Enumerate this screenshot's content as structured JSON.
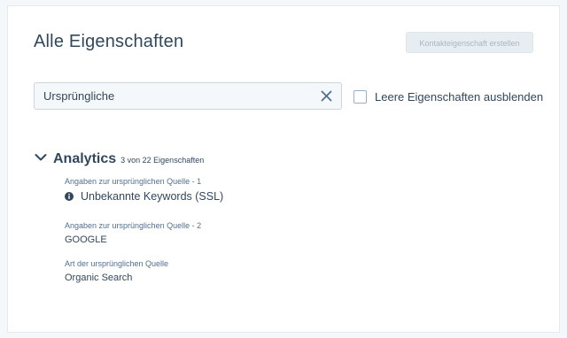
{
  "header": {
    "title": "Alle Eigenschaften",
    "create_button_label": "Kontakteigenschaft erstellen"
  },
  "search": {
    "value": "Ursprüngliche",
    "placeholder": "",
    "clear_icon": "close-icon"
  },
  "filter": {
    "hide_empty_label": "Leere Eigenschaften ausblenden",
    "hide_empty_checked": false
  },
  "section": {
    "title": "Analytics",
    "count_text": "3 von 22 Eigenschaften",
    "expanded": true,
    "properties": [
      {
        "label": "Angaben zur ursprünglichen Quelle - 1",
        "value": "Unbekannte Keywords (SSL)",
        "icon": "info-icon"
      },
      {
        "label": "Angaben zur ursprünglichen Quelle - 2",
        "value": "GOOGLE"
      },
      {
        "label": "Art der ursprünglichen Quelle",
        "value": "Organic Search"
      }
    ]
  },
  "colors": {
    "background": "#f5f8fa",
    "text": "#33475b",
    "label": "#516f90",
    "accent": "#0091ae",
    "disabled_button": "#e8edf2"
  }
}
